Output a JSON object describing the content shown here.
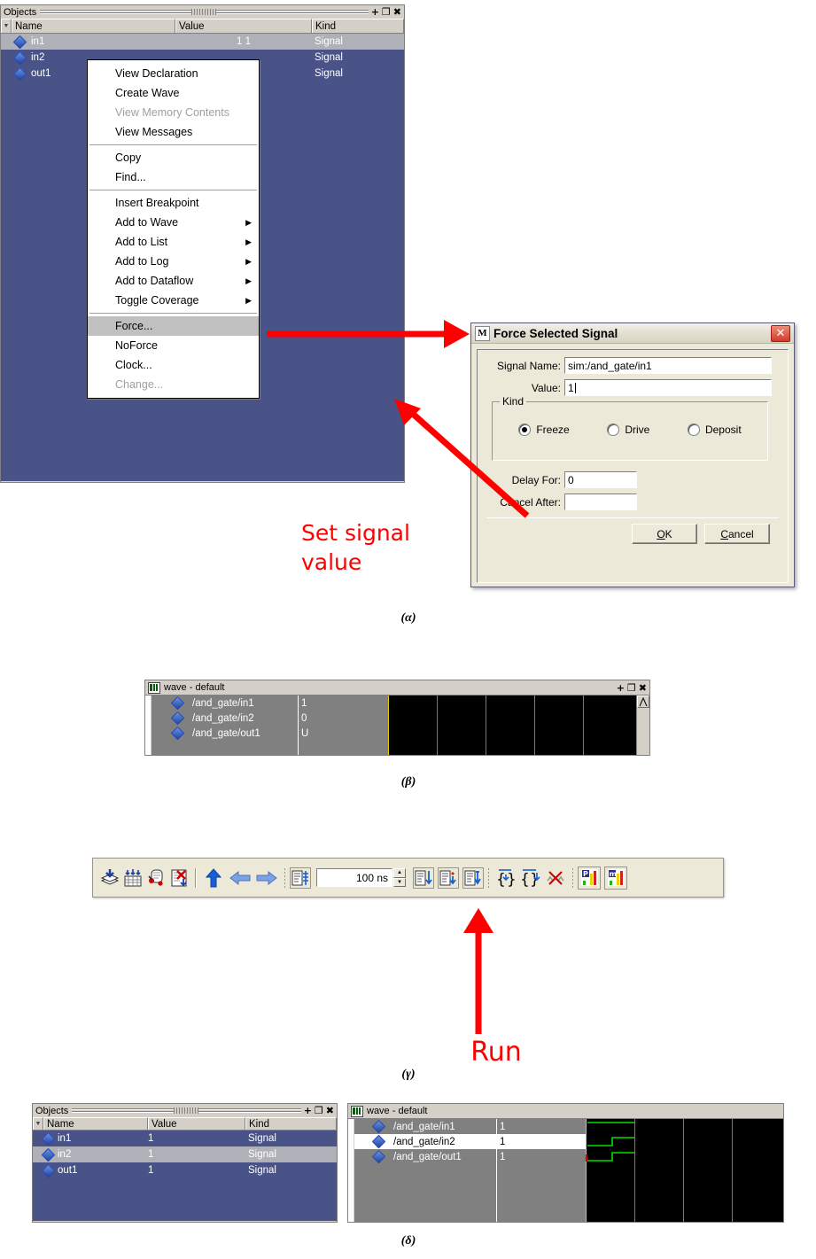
{
  "figure": {
    "captions": {
      "alpha": "(α)",
      "beta": "(β)",
      "gamma": "(γ)",
      "delta": "(δ)"
    },
    "annotations": {
      "set_signal_value": "Set signal\nvalue",
      "run": "Run"
    },
    "accent_red": "#ff0000"
  },
  "objects_panel_a": {
    "title": "Objects",
    "title_buttons": [
      "+",
      "❐",
      "✖"
    ],
    "columns": [
      "Name",
      "Value",
      "Kind"
    ],
    "rows": [
      {
        "name": "in1",
        "value": "1 1",
        "kind": "Signal",
        "selected": true
      },
      {
        "name": "in2",
        "value": "",
        "kind": "Signal",
        "selected": false
      },
      {
        "name": "out1",
        "value": "",
        "kind": "Signal",
        "selected": false
      }
    ]
  },
  "context_menu": {
    "groups": [
      [
        {
          "label": "View Declaration",
          "disabled": false,
          "submenu": false,
          "highlighted": false
        },
        {
          "label": "Create Wave",
          "disabled": false,
          "submenu": false,
          "highlighted": false
        },
        {
          "label": "View Memory Contents",
          "disabled": true,
          "submenu": false,
          "highlighted": false
        },
        {
          "label": "View Messages",
          "disabled": false,
          "submenu": false,
          "highlighted": false
        }
      ],
      [
        {
          "label": "Copy",
          "disabled": false,
          "submenu": false,
          "highlighted": false
        },
        {
          "label": "Find...",
          "disabled": false,
          "submenu": false,
          "highlighted": false
        }
      ],
      [
        {
          "label": "Insert Breakpoint",
          "disabled": false,
          "submenu": false,
          "highlighted": false
        },
        {
          "label": "Add to Wave",
          "disabled": false,
          "submenu": true,
          "highlighted": false
        },
        {
          "label": "Add to List",
          "disabled": false,
          "submenu": true,
          "highlighted": false
        },
        {
          "label": "Add to Log",
          "disabled": false,
          "submenu": true,
          "highlighted": false
        },
        {
          "label": "Add to Dataflow",
          "disabled": false,
          "submenu": true,
          "highlighted": false
        },
        {
          "label": "Toggle Coverage",
          "disabled": false,
          "submenu": true,
          "highlighted": false
        }
      ],
      [
        {
          "label": "Force...",
          "disabled": false,
          "submenu": false,
          "highlighted": true
        },
        {
          "label": "NoForce",
          "disabled": false,
          "submenu": false,
          "highlighted": false
        },
        {
          "label": "Clock...",
          "disabled": false,
          "submenu": false,
          "highlighted": false
        },
        {
          "label": "Change...",
          "disabled": true,
          "submenu": false,
          "highlighted": false
        }
      ]
    ]
  },
  "force_dialog": {
    "icon_letter": "M",
    "title": "Force Selected Signal",
    "close_label": "✕",
    "fields": {
      "signal_name_label": "Signal Name:",
      "signal_name_value": "sim:/and_gate/in1",
      "value_label": "Value:",
      "value_value": "1",
      "delay_label": "Delay For:",
      "delay_value": "0",
      "cancel_after_label": "Cancel After:",
      "cancel_after_value": ""
    },
    "kind": {
      "legend": "Kind",
      "options": [
        {
          "label": "Freeze",
          "selected": true
        },
        {
          "label": "Drive",
          "selected": false
        },
        {
          "label": "Deposit",
          "selected": false
        }
      ]
    },
    "buttons": {
      "ok": "OK",
      "ok_mnemonic": "O",
      "cancel": "Cancel",
      "cancel_mnemonic": "C"
    }
  },
  "wave_panel_b": {
    "title": "wave - default",
    "title_buttons": [
      "+",
      "❐",
      "✖"
    ],
    "signals": [
      {
        "name": "/and_gate/in1",
        "value": "1",
        "highlighted": false
      },
      {
        "name": "/and_gate/in2",
        "value": "0",
        "highlighted": false
      },
      {
        "name": "/and_gate/out1",
        "value": "U",
        "highlighted": false
      }
    ],
    "waveform": {
      "visible": false,
      "grid_count": 5,
      "cursor": true
    }
  },
  "toolbar_c": {
    "run_length": "100 ns",
    "icons_left": [
      "load-layers-icon",
      "restart-icon",
      "inspect-icon",
      "delete-list-icon"
    ],
    "icons_middle": [
      "up-arrow-icon",
      "back-arrow-icon",
      "forward-arrow-icon"
    ],
    "icons_run": [
      "run-icon",
      "continue-run-icon",
      "run-all-icon",
      "break-icon"
    ],
    "icons_step": [
      "step-icon",
      "step-over-icon",
      "step-out-icon"
    ],
    "icons_right": [
      "profile-icon",
      "memory-icon"
    ]
  },
  "objects_panel_d": {
    "title": "Objects",
    "title_buttons": [
      "+",
      "❐",
      "✖"
    ],
    "columns": [
      "Name",
      "Value",
      "Kind"
    ],
    "rows": [
      {
        "name": "in1",
        "value": "1",
        "kind": "Signal",
        "selected": false
      },
      {
        "name": "in2",
        "value": "1",
        "kind": "Signal",
        "selected": true
      },
      {
        "name": "out1",
        "value": "1",
        "kind": "Signal",
        "selected": false
      }
    ]
  },
  "wave_panel_d": {
    "title": "wave - default",
    "signals": [
      {
        "name": "/and_gate/in1",
        "value": "1",
        "highlighted": false
      },
      {
        "name": "/and_gate/in2",
        "value": "1",
        "highlighted": true
      },
      {
        "name": "/and_gate/out1",
        "value": "1",
        "highlighted": false
      }
    ],
    "waveform": {
      "visible": true,
      "trace_color": "#00e000",
      "grid_count": 3,
      "traces": [
        {
          "signal": "/and_gate/in1",
          "levels": [
            1,
            1
          ]
        },
        {
          "signal": "/and_gate/in2",
          "levels": [
            0,
            1
          ]
        },
        {
          "signal": "/and_gate/out1",
          "levels": [
            0,
            1
          ]
        }
      ]
    }
  }
}
